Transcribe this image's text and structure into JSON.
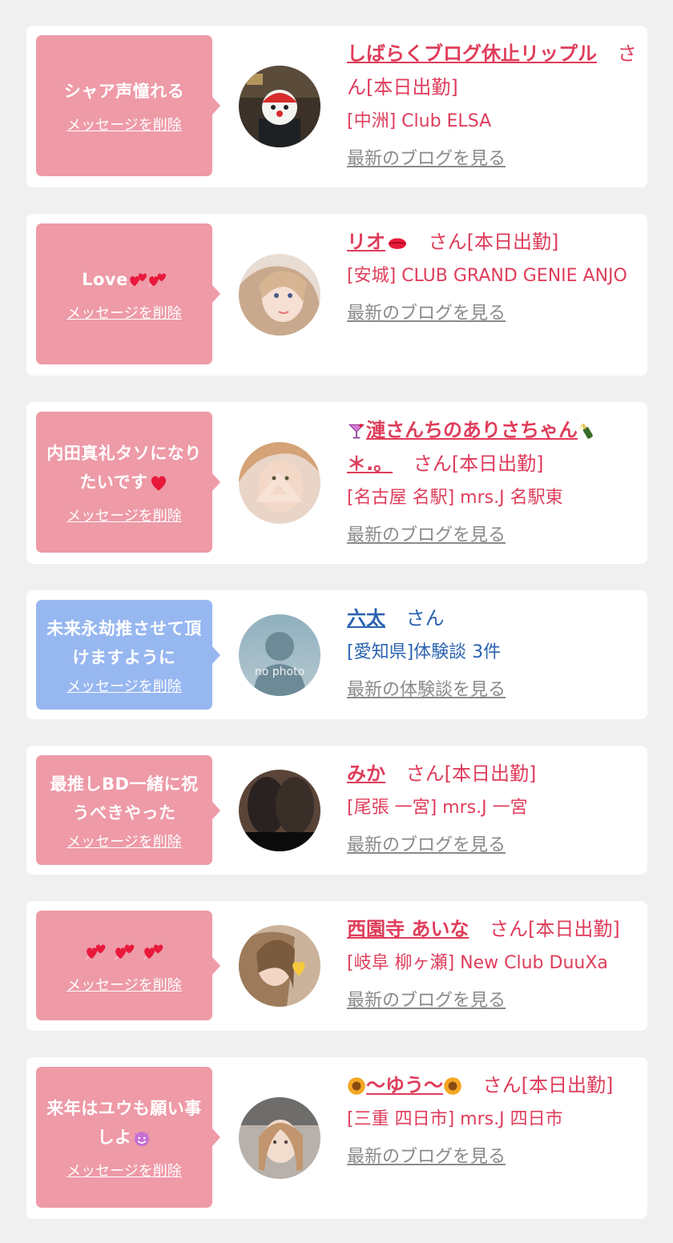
{
  "delete_label": "メッセージを削除",
  "colors": {
    "pink": "#ee9aa7",
    "blue": "#97b7f1",
    "name_red": "#df3d5b",
    "name_blue": "#2b63b0"
  },
  "cards": [
    {
      "message": "シャア声憧れる",
      "name": "しばらくブログ休止リップル",
      "suffix": "さん[本日出勤]",
      "shop": "[中洲] Club ELSA",
      "link": "最新のブログを見る"
    },
    {
      "message": "Love",
      "message_icons": [
        "two-hearts-icon",
        "two-hearts-icon"
      ],
      "name": "リオ",
      "name_icon": "lips-icon",
      "suffix": "さん[本日出勤]",
      "shop": "[安城] CLUB GRAND GENIE ANJO",
      "link": "最新のブログを見る"
    },
    {
      "message": "内田真礼タソになりたいです",
      "message_icon": "red-heart-icon",
      "name": "漣さんちのありさちゃん",
      "name_tail": "＊.。",
      "name_icons": [
        "cocktail-icon",
        "champagne-icon"
      ],
      "suffix": "さん[本日出勤]",
      "shop": "[名古屋 名駅] mrs.J 名駅東",
      "link": "最新のブログを見る"
    },
    {
      "message": "未来永劫推させて頂けますように",
      "name": "六太",
      "suffix": "さん",
      "shop": "[愛知県]体験談 3件",
      "link": "最新の体験談を見る",
      "avatar_text": "no photo"
    },
    {
      "message": "最推しBD一緒に祝うべきやった",
      "name": "みか",
      "suffix": "さん[本日出勤]",
      "shop": "[尾張 一宮] mrs.J 一宮",
      "link": "最新のブログを見る"
    },
    {
      "message_icons": [
        "two-hearts-icon",
        "two-hearts-icon",
        "two-hearts-icon"
      ],
      "name": "西園寺 あいな",
      "suffix": "さん[本日出勤]",
      "shop": "[岐阜 柳ヶ瀬] New Club DuuXa",
      "link": "最新のブログを見る"
    },
    {
      "message": "来年はユウも願い事しよ",
      "message_icon": "smiling-devil-icon",
      "name": "〜ゆう〜",
      "name_icons": [
        "sunflower-icon",
        "sunflower-icon"
      ],
      "suffix": "さん[本日出勤]",
      "shop": "[三重 四日市] mrs.J 四日市",
      "link": "最新のブログを見る"
    }
  ]
}
